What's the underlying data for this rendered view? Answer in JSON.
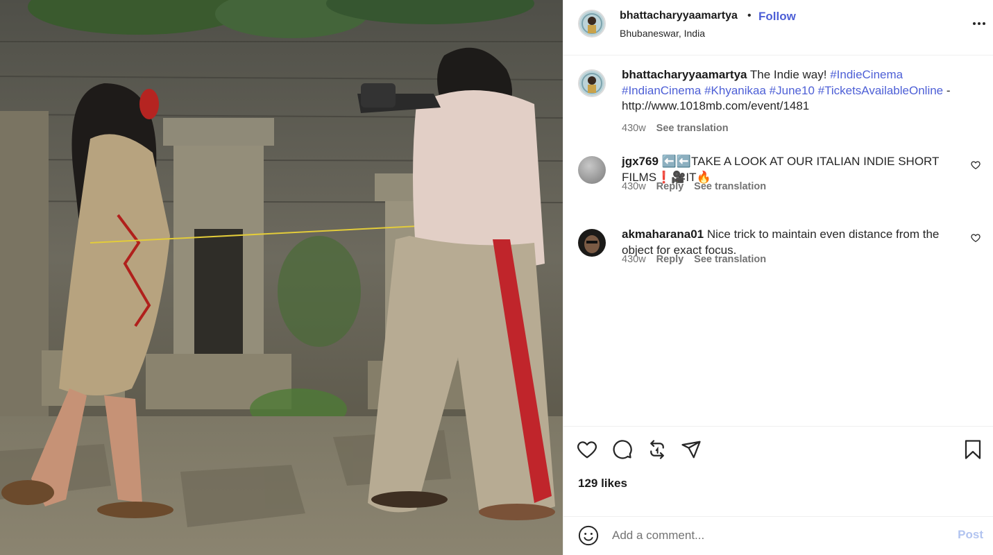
{
  "post": {
    "username": "bhattacharyyaamartya",
    "follow_label": "Follow",
    "location": "Bhubaneswar, India",
    "separator": "•"
  },
  "caption": {
    "username": "bhattacharyyaamartya",
    "text": "The Indie way!",
    "hashtags": [
      "#IndieCinema",
      "#IndianCinema",
      "#Khyanikaa",
      "#June10",
      "#TicketsAvailableOnline"
    ],
    "suffix": "-",
    "link": "http://www.1018mb.com/event/1481",
    "time": "430w",
    "see_translation": "See translation"
  },
  "comments": [
    {
      "username": "jgx769",
      "text": "⬅️⬅️TAKE A LOOK AT OUR ITALIAN INDIE SHORT FILMS❗🎥IT🔥",
      "time": "430w",
      "reply": "Reply",
      "see_translation": "See translation"
    },
    {
      "username": "akmaharana01",
      "text": "Nice trick to maintain even distance from the object for exact focus.",
      "time": "430w",
      "reply": "Reply",
      "see_translation": "See translation"
    }
  ],
  "likes": "129 likes",
  "add_comment": {
    "placeholder": "Add a comment...",
    "post_label": "Post"
  },
  "icons": {
    "more": "more-options-icon",
    "like": "heart-icon",
    "comment": "comment-icon",
    "share": "repost-icon",
    "send": "send-icon",
    "save": "bookmark-icon",
    "emoji": "emoji-icon"
  },
  "colors": {
    "accent": "#4d5fd6",
    "post_disabled": "#b2c4f0",
    "muted": "#737373"
  }
}
